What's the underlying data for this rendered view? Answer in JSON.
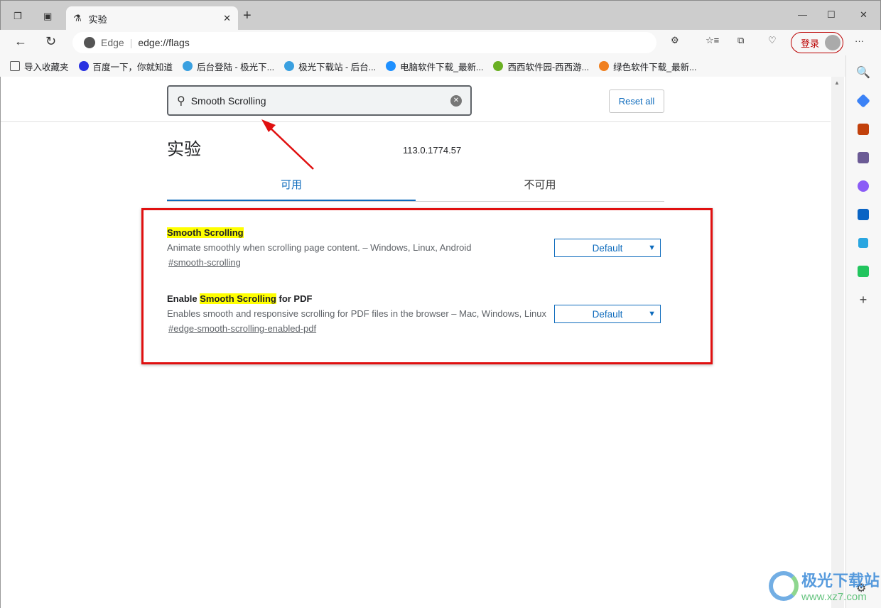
{
  "tab": {
    "title": "实验",
    "icon": "flask-icon"
  },
  "window": {
    "minimize": "—",
    "maximize": "☐",
    "close": "✕"
  },
  "address": {
    "site": "Edge",
    "url": "edge://flags"
  },
  "profile": {
    "login": "登录"
  },
  "bookmarks": [
    {
      "label": "导入收藏夹",
      "color": "#555"
    },
    {
      "label": "百度一下，你就知道",
      "color": "#2932e1"
    },
    {
      "label": "后台登陆 - 极光下...",
      "color": "#3aa0e0"
    },
    {
      "label": "极光下载站 - 后台...",
      "color": "#3aa0e0"
    },
    {
      "label": "电脑软件下载_最新...",
      "color": "#1e90ff"
    },
    {
      "label": "西西软件园-西西游...",
      "color": "#6ab023"
    },
    {
      "label": "绿色软件下载_最新...",
      "color": "#f08020"
    }
  ],
  "search": {
    "value": "Smooth Scrolling"
  },
  "reset_label": "Reset all",
  "page": {
    "title": "实验",
    "version": "113.0.1774.57"
  },
  "tabs": [
    {
      "label": "可用",
      "active": true
    },
    {
      "label": "不可用",
      "active": false
    }
  ],
  "flags": [
    {
      "title_pre": "",
      "title_hl": "Smooth Scrolling",
      "title_post": "",
      "desc": "Animate smoothly when scrolling page content. – Windows, Linux, Android",
      "link": "#smooth-scrolling",
      "value": "Default"
    },
    {
      "title_pre": "Enable ",
      "title_hl": "Smooth Scrolling",
      "title_post": " for PDF",
      "desc": "Enables smooth and responsive scrolling for PDF files in the browser – Mac, Windows, Linux",
      "link": "#edge-smooth-scrolling-enabled-pdf",
      "value": "Default"
    }
  ],
  "colors": {
    "accent": "#0f6cbd",
    "highlight": "#ffff00",
    "annotation": "#e01010"
  },
  "watermark": {
    "text": "极光下载站",
    "url": "www.xz7.com"
  }
}
